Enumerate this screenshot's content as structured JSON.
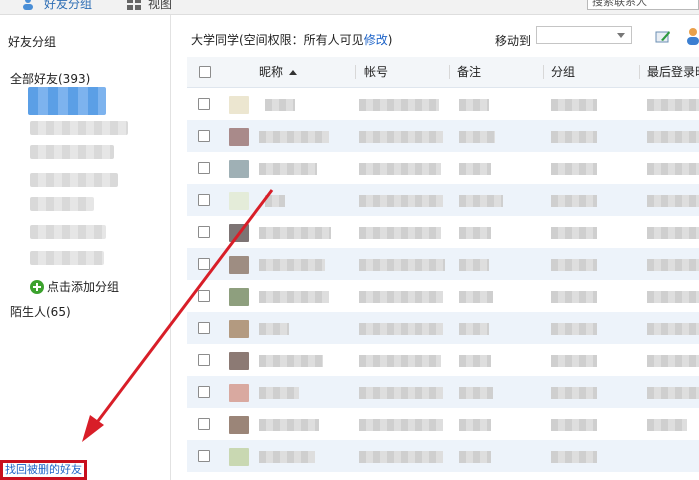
{
  "toolbar": {
    "friend_group_label": "好友分组",
    "view_label": "视图",
    "search_value": "搜索联系人"
  },
  "sidebar": {
    "title": "好友分组",
    "all_friends": "全部好友(393)",
    "add_group": "点击添加分组",
    "strangers": "陌生人(65)",
    "recover_deleted": "找回被删的好友"
  },
  "main": {
    "group_info_prefix": "大学同学(空间权限：所有人可见",
    "group_info_edit": "修改",
    "group_info_suffix": ")",
    "move_to_label": "移动到",
    "columns": {
      "nickname": "昵称",
      "account": "帐号",
      "remark": "备注",
      "group": "分组",
      "last_login": "最后登录时"
    }
  },
  "colors": {
    "accent_link": "#1e64c8",
    "highlight_box": "#c8101e",
    "arrow": "#d81e28",
    "row_alt": "#edf3fa"
  }
}
